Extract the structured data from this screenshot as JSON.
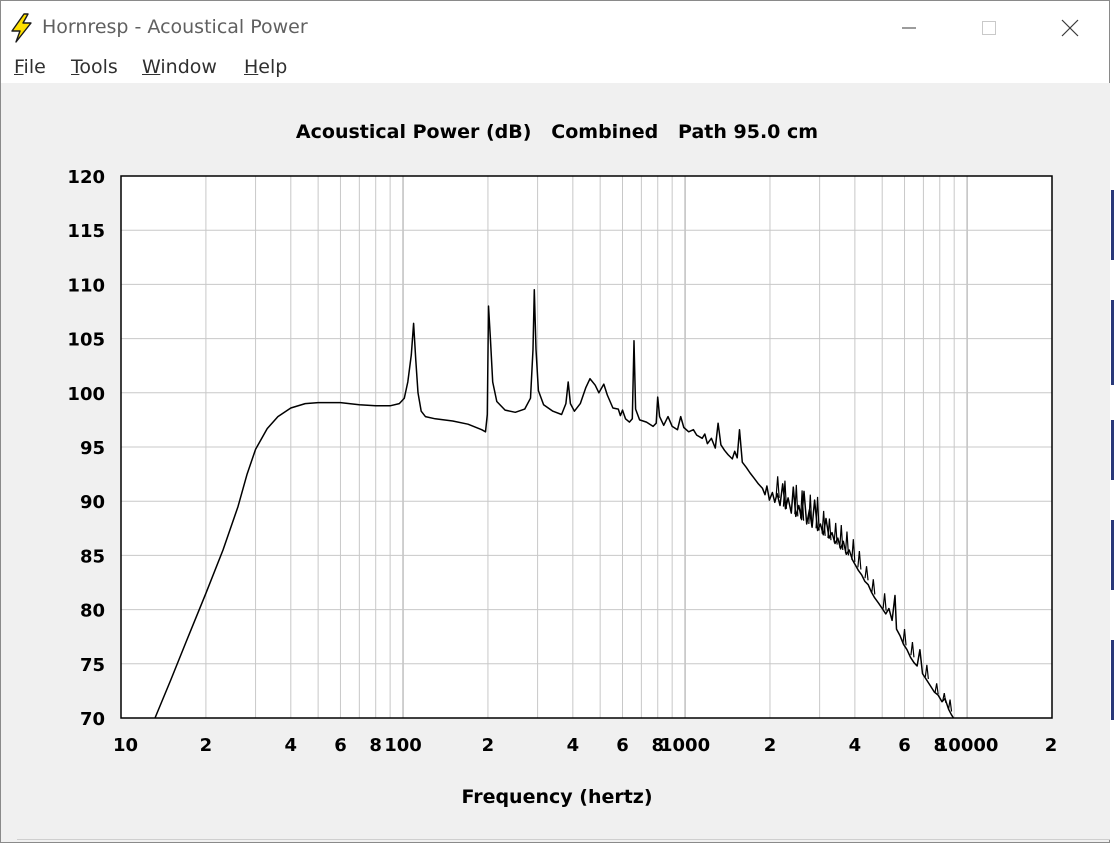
{
  "window": {
    "title": "Hornresp - Acoustical Power",
    "icon": "lightning-bolt-icon",
    "controls": [
      "minimize-icon",
      "maximize-icon",
      "close-icon"
    ]
  },
  "menu": {
    "items": [
      {
        "mnemonic": "F",
        "rest": "ile"
      },
      {
        "mnemonic": "T",
        "rest": "ools"
      },
      {
        "mnemonic": "W",
        "rest": "indow"
      },
      {
        "mnemonic": "H",
        "rest": "elp"
      }
    ]
  },
  "colors": {
    "plot_background": "#ffffff",
    "grid": "#c8c8c8",
    "trace": "#000000",
    "window_background": "#f0f0f0",
    "icon_yellow": "#ffe000"
  },
  "chart_data": {
    "type": "line",
    "title": "Acoustical Power (dB)   Combined   Path 95.0 cm",
    "xlabel": "Frequency (hertz)",
    "ylabel": "",
    "x_scale": "log",
    "xlim": [
      10,
      20000
    ],
    "ylim": [
      70,
      120
    ],
    "y_ticks": [
      "120",
      "115",
      "110",
      "105",
      "100",
      "95",
      "90",
      "85",
      "80",
      "75",
      "70"
    ],
    "x_tick_labels": [
      {
        "value": 10,
        "label": "10"
      },
      {
        "value": 20,
        "label": "2"
      },
      {
        "value": 40,
        "label": "4"
      },
      {
        "value": 60,
        "label": "6"
      },
      {
        "value": 80,
        "label": "8"
      },
      {
        "value": 100,
        "label": "100"
      },
      {
        "value": 200,
        "label": "2"
      },
      {
        "value": 400,
        "label": "4"
      },
      {
        "value": 600,
        "label": "6"
      },
      {
        "value": 800,
        "label": "8"
      },
      {
        "value": 1000,
        "label": "1000"
      },
      {
        "value": 2000,
        "label": "2"
      },
      {
        "value": 4000,
        "label": "4"
      },
      {
        "value": 6000,
        "label": "6"
      },
      {
        "value": 8000,
        "label": "8"
      },
      {
        "value": 10000,
        "label": "10000"
      },
      {
        "value": 20000,
        "label": "2"
      }
    ],
    "grid": true,
    "series": [
      {
        "points": [
          [
            13.2,
            70
          ],
          [
            15,
            73.5
          ],
          [
            17,
            77
          ],
          [
            20,
            81.5
          ],
          [
            23,
            85.5
          ],
          [
            26,
            89.5
          ],
          [
            28,
            92.5
          ],
          [
            30,
            94.8
          ],
          [
            33,
            96.7
          ],
          [
            36,
            97.8
          ],
          [
            40,
            98.6
          ],
          [
            45,
            99.0
          ],
          [
            50,
            99.1
          ],
          [
            60,
            99.1
          ],
          [
            70,
            98.9
          ],
          [
            80,
            98.8
          ],
          [
            90,
            98.8
          ],
          [
            97,
            99.0
          ],
          [
            101,
            99.5
          ],
          [
            104,
            101
          ],
          [
            107,
            103.5
          ],
          [
            109,
            106.4
          ],
          [
            111,
            103
          ],
          [
            113,
            100
          ],
          [
            116,
            98.3
          ],
          [
            120,
            97.8
          ],
          [
            130,
            97.6
          ],
          [
            150,
            97.4
          ],
          [
            170,
            97.1
          ],
          [
            190,
            96.6
          ],
          [
            196,
            96.4
          ],
          [
            199,
            98
          ],
          [
            201,
            108
          ],
          [
            204,
            105
          ],
          [
            208,
            101
          ],
          [
            215,
            99.2
          ],
          [
            230,
            98.4
          ],
          [
            250,
            98.2
          ],
          [
            270,
            98.5
          ],
          [
            283,
            99.5
          ],
          [
            289,
            104
          ],
          [
            292,
            109.5
          ],
          [
            296,
            104
          ],
          [
            302,
            100.2
          ],
          [
            315,
            98.9
          ],
          [
            340,
            98.3
          ],
          [
            365,
            98.0
          ],
          [
            378,
            99.0
          ],
          [
            385,
            101.0
          ],
          [
            392,
            99.0
          ],
          [
            405,
            98.3
          ],
          [
            425,
            99.0
          ],
          [
            445,
            100.5
          ],
          [
            460,
            101.3
          ],
          [
            480,
            100.7
          ],
          [
            495,
            100.0
          ],
          [
            515,
            100.8
          ],
          [
            530,
            99.8
          ],
          [
            555,
            98.6
          ],
          [
            580,
            98.5
          ],
          [
            590,
            97.9
          ],
          [
            600,
            98.4
          ],
          [
            615,
            97.6
          ],
          [
            635,
            97.3
          ],
          [
            650,
            97.6
          ],
          [
            659,
            104.8
          ],
          [
            668,
            98.5
          ],
          [
            690,
            97.5
          ],
          [
            730,
            97.3
          ],
          [
            770,
            96.9
          ],
          [
            790,
            97.2
          ],
          [
            800,
            99.6
          ],
          [
            812,
            97.8
          ],
          [
            840,
            97.0
          ],
          [
            870,
            97.8
          ],
          [
            900,
            96.9
          ],
          [
            940,
            96.6
          ],
          [
            965,
            97.8
          ],
          [
            990,
            96.8
          ],
          [
            1030,
            96.4
          ],
          [
            1070,
            96.6
          ],
          [
            1100,
            96.1
          ],
          [
            1150,
            95.8
          ],
          [
            1175,
            96.2
          ],
          [
            1200,
            95.3
          ],
          [
            1240,
            95.8
          ],
          [
            1280,
            94.9
          ],
          [
            1310,
            97.2
          ],
          [
            1340,
            95.2
          ],
          [
            1380,
            94.7
          ],
          [
            1420,
            94.3
          ],
          [
            1470,
            93.9
          ],
          [
            1500,
            94.6
          ],
          [
            1530,
            94.0
          ],
          [
            1560,
            96.6
          ],
          [
            1595,
            93.6
          ],
          [
            1650,
            93.1
          ],
          [
            1700,
            92.6
          ],
          [
            1760,
            92.1
          ],
          [
            1820,
            91.6
          ],
          [
            1880,
            91.2
          ],
          [
            1920,
            90.6
          ],
          [
            1950,
            91.4
          ],
          [
            1990,
            90.1
          ],
          [
            2040,
            90.8
          ],
          [
            2080,
            89.9
          ],
          [
            2120,
            90.7
          ],
          [
            2170,
            89.6
          ],
          [
            2220,
            91.6
          ],
          [
            2270,
            89.3
          ],
          [
            2320,
            90.3
          ],
          [
            2380,
            88.9
          ],
          [
            2420,
            91.3
          ],
          [
            2470,
            88.6
          ],
          [
            2530,
            89.6
          ],
          [
            2590,
            88.3
          ],
          [
            2640,
            90.9
          ],
          [
            2700,
            87.9
          ],
          [
            2760,
            89.2
          ],
          [
            2820,
            87.6
          ],
          [
            2880,
            90.1
          ],
          [
            2950,
            87.3
          ],
          [
            3020,
            87.9
          ],
          [
            3090,
            86.9
          ],
          [
            3160,
            88.4
          ],
          [
            3240,
            86.6
          ],
          [
            3320,
            87.1
          ],
          [
            3400,
            86.1
          ],
          [
            3480,
            86.6
          ],
          [
            3560,
            85.6
          ],
          [
            3640,
            86.3
          ],
          [
            3730,
            85.1
          ],
          [
            3820,
            85.5
          ],
          [
            3920,
            84.6
          ],
          [
            4020,
            84.1
          ],
          [
            4120,
            83.6
          ],
          [
            4230,
            83.2
          ],
          [
            4340,
            82.6
          ],
          [
            4460,
            82.3
          ],
          [
            4580,
            81.6
          ],
          [
            4700,
            81.1
          ],
          [
            4850,
            80.6
          ],
          [
            5000,
            80.1
          ],
          [
            5150,
            79.6
          ],
          [
            5280,
            80.1
          ],
          [
            5420,
            79.0
          ],
          [
            5550,
            81.3
          ],
          [
            5620,
            78.2
          ],
          [
            5780,
            77.6
          ],
          [
            5950,
            76.8
          ],
          [
            6120,
            76.3
          ],
          [
            6300,
            75.6
          ],
          [
            6480,
            75.1
          ],
          [
            6650,
            74.8
          ],
          [
            6800,
            76.3
          ],
          [
            6950,
            74.1
          ],
          [
            7150,
            73.6
          ],
          [
            7400,
            73.0
          ],
          [
            7650,
            72.4
          ],
          [
            7900,
            72.1
          ],
          [
            8150,
            71.5
          ],
          [
            8350,
            71.8
          ],
          [
            8600,
            70.8
          ],
          [
            8800,
            70.3
          ],
          [
            8950,
            70.0
          ]
        ]
      }
    ],
    "spikes": [
      [
        2130,
        90.5,
        92.3
      ],
      [
        2260,
        89.5,
        91.9
      ],
      [
        2480,
        88.8,
        91.5
      ],
      [
        2600,
        88.4,
        91.0
      ],
      [
        2780,
        87.9,
        90.6
      ],
      [
        2950,
        87.5,
        90.4
      ],
      [
        3100,
        87.0,
        89.1
      ],
      [
        3250,
        86.6,
        88.4
      ],
      [
        3420,
        86.2,
        88.0
      ],
      [
        3580,
        85.7,
        87.8
      ],
      [
        3750,
        85.2,
        87.2
      ],
      [
        3950,
        84.6,
        86.5
      ],
      [
        4150,
        83.9,
        85.4
      ],
      [
        4400,
        82.9,
        84.0
      ],
      [
        4650,
        81.6,
        82.8
      ],
      [
        5100,
        80.1,
        81.5
      ],
      [
        6000,
        76.9,
        78.2
      ],
      [
        6400,
        75.8,
        77.0
      ],
      [
        7200,
        73.8,
        74.9
      ],
      [
        7800,
        72.4,
        73.2
      ],
      [
        8300,
        71.6,
        72.3
      ],
      [
        8700,
        70.8,
        71.7
      ]
    ]
  }
}
